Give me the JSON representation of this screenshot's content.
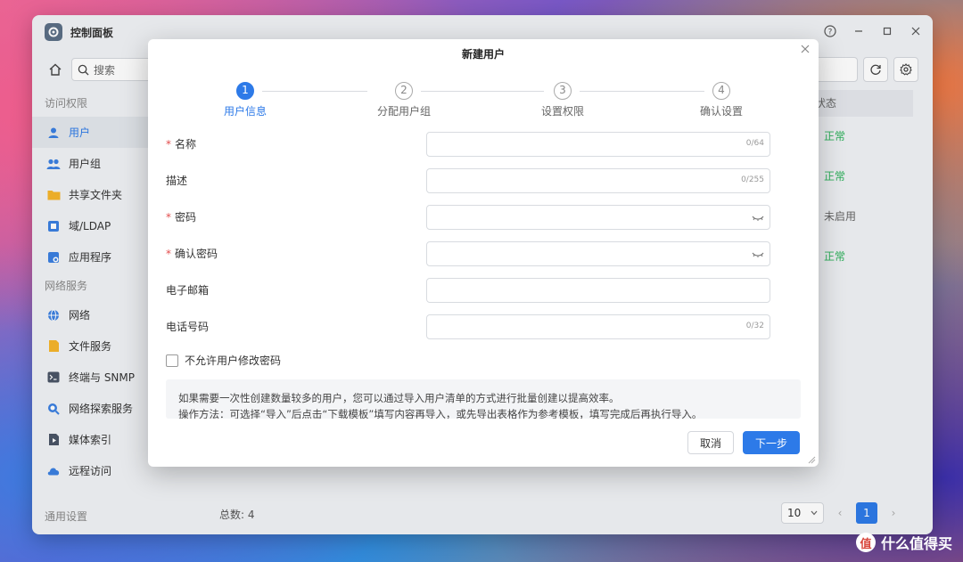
{
  "window": {
    "title": "控制面板",
    "controls": [
      "?",
      "–",
      "□",
      "✕"
    ]
  },
  "toolbar": {
    "search_placeholder": "搜索"
  },
  "sidebar": {
    "sections": [
      {
        "title": "访问权限",
        "items": [
          {
            "label": "用户",
            "icon": "user-icon",
            "active": true,
            "color": "#3b7fe0"
          },
          {
            "label": "用户组",
            "icon": "users-icon",
            "active": false,
            "color": "#3b7fe0"
          },
          {
            "label": "共享文件夹",
            "icon": "folder-icon",
            "active": false,
            "color": "#f5b52b"
          },
          {
            "label": "域/LDAP",
            "icon": "domain-icon",
            "active": false,
            "color": "#3b7fe0"
          },
          {
            "label": "应用程序",
            "icon": "apps-icon",
            "active": false,
            "color": "#3b7fe0"
          }
        ]
      },
      {
        "title": "网络服务",
        "items": [
          {
            "label": "网络",
            "icon": "globe-icon",
            "active": false,
            "color": "#3b7fe0"
          },
          {
            "label": "文件服务",
            "icon": "file-service-icon",
            "active": false,
            "color": "#f5b52b"
          },
          {
            "label": "终端与 SNMP",
            "icon": "terminal-icon",
            "active": false,
            "color": "#4a5566"
          },
          {
            "label": "网络探索服务",
            "icon": "discovery-icon",
            "active": false,
            "color": "#3b7fe0"
          },
          {
            "label": "媒体索引",
            "icon": "media-icon",
            "active": false,
            "color": "#4a5566"
          },
          {
            "label": "远程访问",
            "icon": "cloud-icon",
            "active": false,
            "color": "#3b7fe0"
          }
        ]
      }
    ],
    "footer": "通用设置"
  },
  "table": {
    "status_header": "状态",
    "statuses": [
      {
        "text": "正常",
        "kind": "ok"
      },
      {
        "text": "正常",
        "kind": "ok"
      },
      {
        "text": "未启用",
        "kind": "off"
      },
      {
        "text": "正常",
        "kind": "ok"
      }
    ],
    "total_label": "总数: 4",
    "page_size": "10",
    "current_page": "1"
  },
  "dialog": {
    "title": "新建用户",
    "steps": [
      {
        "num": "1",
        "label": "用户信息",
        "active": true
      },
      {
        "num": "2",
        "label": "分配用户组",
        "active": false
      },
      {
        "num": "3",
        "label": "设置权限",
        "active": false
      },
      {
        "num": "4",
        "label": "确认设置",
        "active": false
      }
    ],
    "fields": {
      "name": {
        "label": "名称",
        "required": true,
        "value": "",
        "counter": "0/64"
      },
      "description": {
        "label": "描述",
        "required": false,
        "value": "",
        "counter": "0/255"
      },
      "password": {
        "label": "密码",
        "required": true,
        "value": ""
      },
      "confirm_password": {
        "label": "确认密码",
        "required": true,
        "value": ""
      },
      "email": {
        "label": "电子邮箱",
        "required": false,
        "value": ""
      },
      "phone": {
        "label": "电话号码",
        "required": false,
        "value": "",
        "counter": "0/32"
      }
    },
    "checkbox_label": "不允许用户修改密码",
    "checkbox_checked": false,
    "info_lines": [
      "如果需要一次性创建数量较多的用户，您可以通过导入用户清单的方式进行批量创建以提高效率。",
      "操作方法：可选择“导入”后点击“下载模板”填写内容再导入，或先导出表格作为参考模板，填写完成后再执行导入。"
    ],
    "cancel_label": "取消",
    "next_label": "下一步"
  },
  "watermark": {
    "logo_char": "值",
    "text": "什么值得买"
  },
  "colors": {
    "accent": "#2d7ae8",
    "ok": "#2eb35c",
    "required": "#e34d4d"
  }
}
